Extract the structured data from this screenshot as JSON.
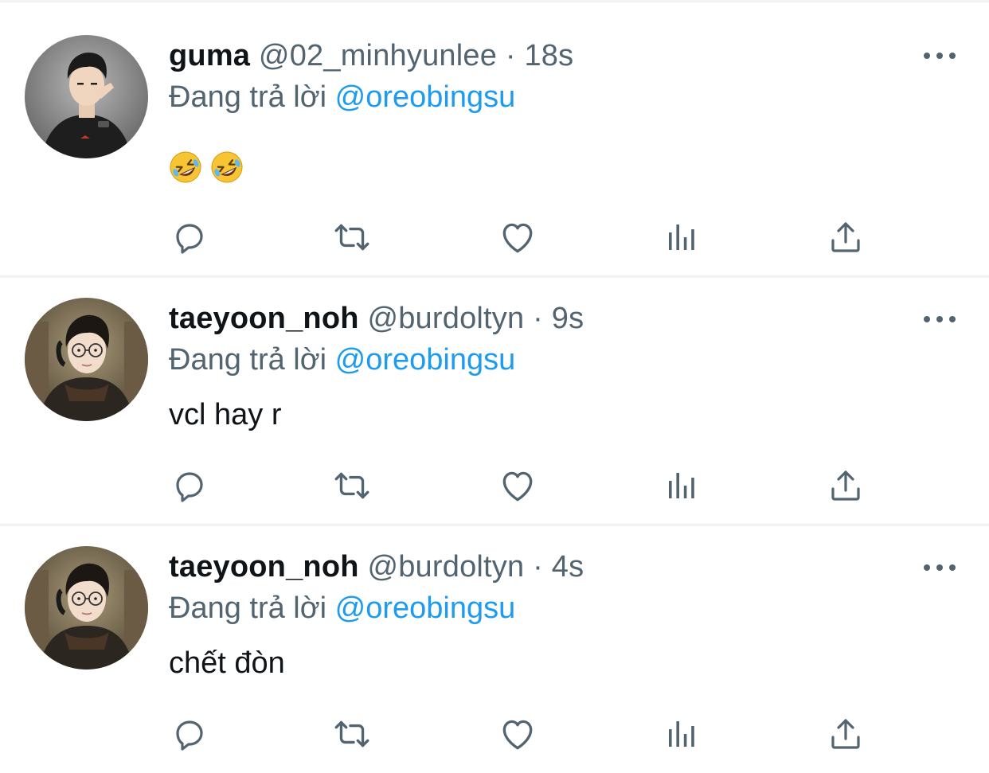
{
  "colors": {
    "text_primary": "#0f1419",
    "text_secondary": "#536471",
    "mention": "#1d9bf0",
    "icon": "#536471",
    "divider": "#eff3f4"
  },
  "tweets": [
    {
      "display_name": "guma",
      "handle": "@02_minhyunlee",
      "separator": "·",
      "time": "18s",
      "reply_prefix": "Đang trả lời",
      "reply_to": "@oreobingsu",
      "text": "",
      "emojis": [
        "rolling-on-floor-laughing",
        "rolling-on-floor-laughing"
      ],
      "avatar": "guma-avatar"
    },
    {
      "display_name": "taeyoon_noh",
      "handle": "@burdoltyn",
      "separator": "·",
      "time": "9s",
      "reply_prefix": "Đang trả lời",
      "reply_to": "@oreobingsu",
      "text": "vcl hay r",
      "emojis": [],
      "avatar": "taeyoon-avatar"
    },
    {
      "display_name": "taeyoon_noh",
      "handle": "@burdoltyn",
      "separator": "·",
      "time": "4s",
      "reply_prefix": "Đang trả lời",
      "reply_to": "@oreobingsu",
      "text": "chết đòn",
      "emojis": [],
      "avatar": "taeyoon-avatar"
    }
  ],
  "action_icons": [
    "reply-icon",
    "retweet-icon",
    "like-icon",
    "analytics-icon",
    "share-icon"
  ],
  "more_icon": "more-icon"
}
